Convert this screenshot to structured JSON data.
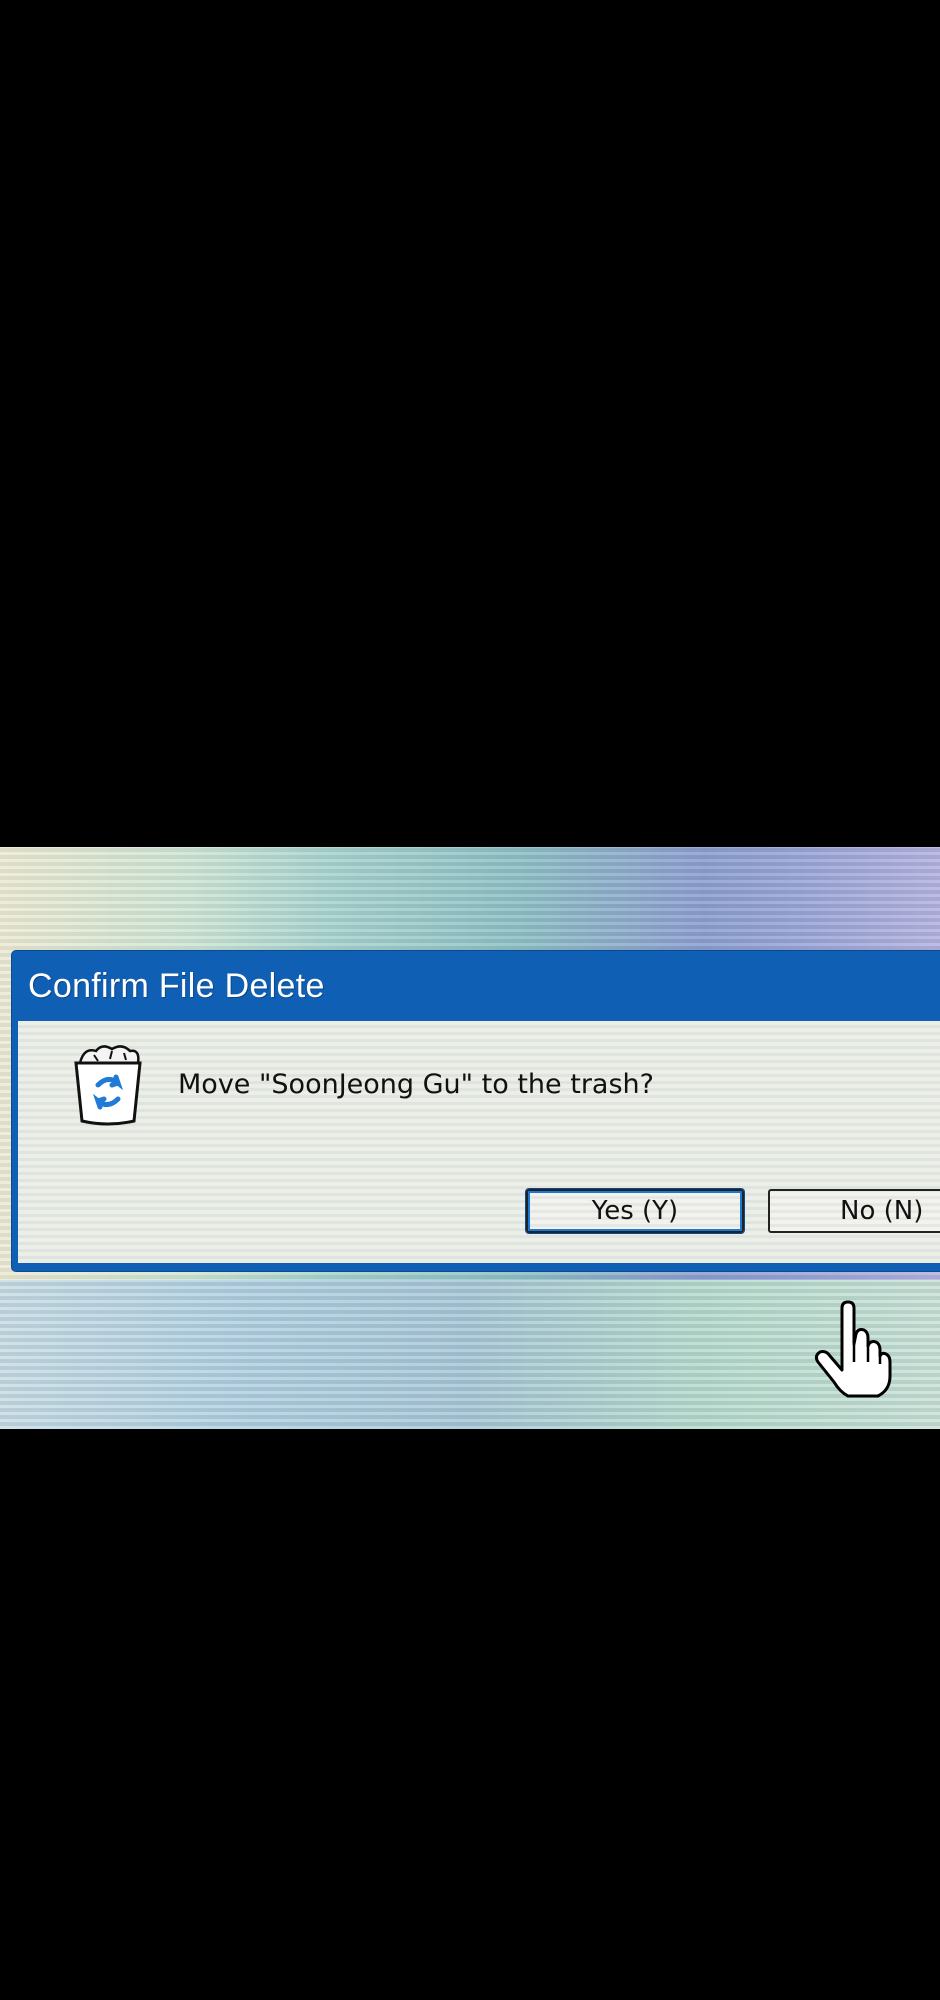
{
  "dialog": {
    "title": "Confirm File Delete",
    "message": "Move \"SoonJeong Gu\" to the trash?",
    "yes_label": "Yes (Y)",
    "no_label": "No (N)"
  },
  "icons": {
    "trash": "trash-icon",
    "cursor": "hand-pointer-cursor-icon"
  },
  "colors": {
    "titlebar": "#0f5fb4",
    "focus_ring": "#1a78d4",
    "recycle_arrows": "#1f7ad8"
  }
}
